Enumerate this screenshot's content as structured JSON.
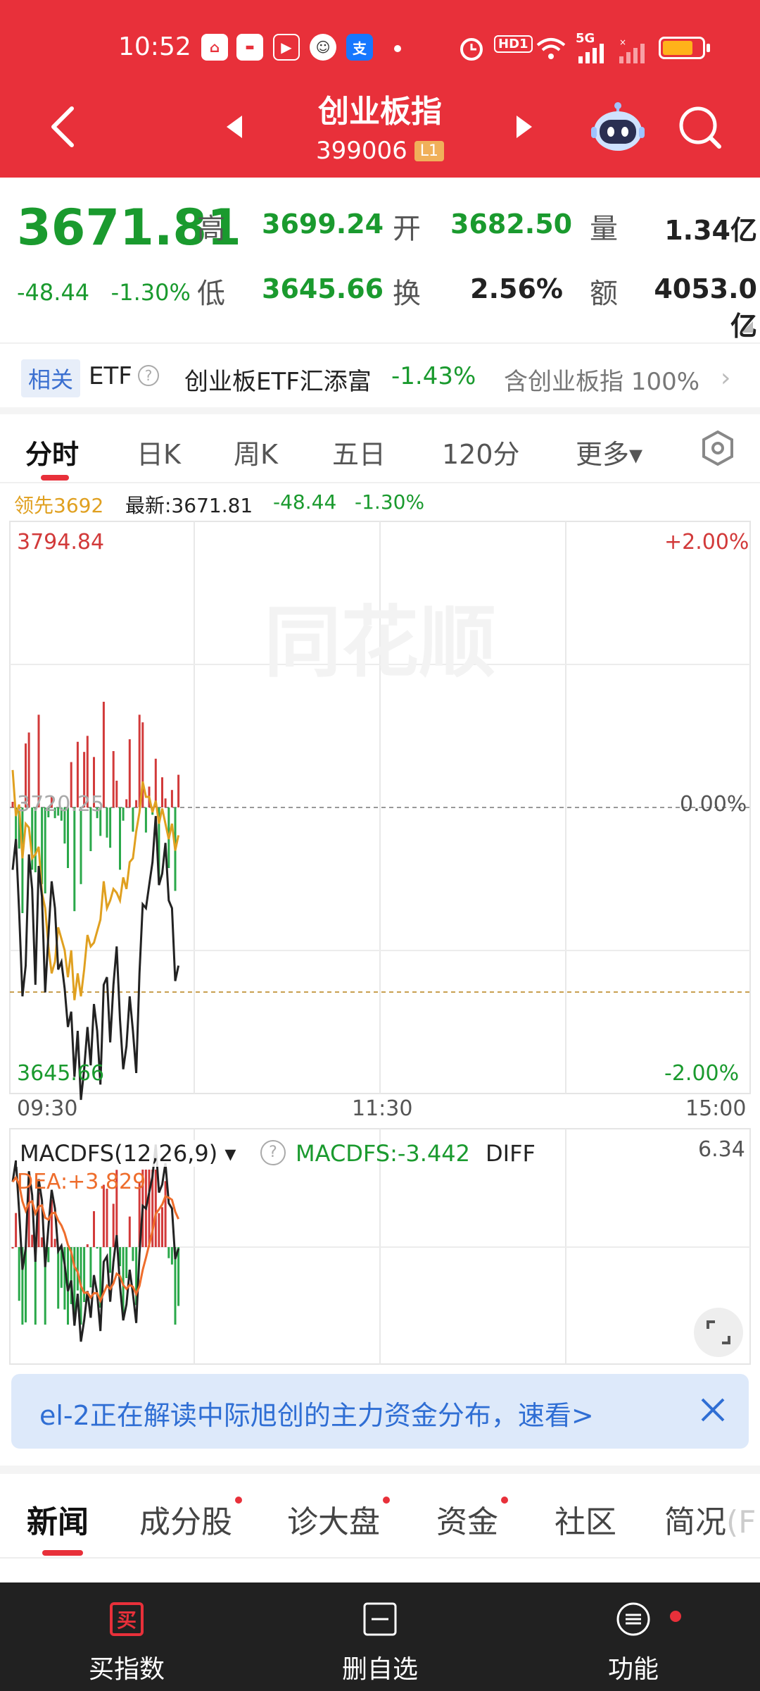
{
  "status_bar": {
    "time": "10:52",
    "network": "5G",
    "hd_label": "HD1"
  },
  "header": {
    "title": "创业板指",
    "code": "399006",
    "level": "L1"
  },
  "quote": {
    "price": "3671.81",
    "change": "-48.44",
    "change_pct": "-1.30%",
    "high_label": "高",
    "high": "3699.24",
    "open_label": "开",
    "open": "3682.50",
    "vol_label": "量",
    "volume": "1.34亿",
    "low_label": "低",
    "low": "3645.66",
    "turnover_label": "换",
    "turnover": "2.56%",
    "amount_label": "额",
    "amount": "4053.0亿"
  },
  "etf": {
    "tag": "相关",
    "label": "ETF",
    "name": "创业板ETF汇添富",
    "change": "-1.43%",
    "contains": "含创业板指 100%"
  },
  "chart_tabs": [
    "分时",
    "日K",
    "周K",
    "五日",
    "120分",
    "更多▾"
  ],
  "legend": {
    "lead": "领先3692",
    "latest": "最新:3671.81",
    "change": "-48.44",
    "change_pct": "-1.30%"
  },
  "chart_axes": {
    "top_price": "3794.84",
    "top_pct": "+2.00%",
    "mid_price": "3720.25",
    "mid_pct": "0.00%",
    "bottom_price": "3645.66",
    "bottom_pct": "-2.00%",
    "times": [
      "09:30",
      "11:30",
      "15:00"
    ]
  },
  "macd": {
    "label": "MACDFS(12,26,9)",
    "value": "MACDFS:-3.442",
    "diff": "DIFF",
    "dea": "DEA:+3.829",
    "max": "6.34"
  },
  "colors": {
    "brand_red": "#e8303a",
    "down_green": "#1a9a2e",
    "lead_line": "#e0a020",
    "price_line": "#222222",
    "dea_line": "#ee6d2c",
    "banner_blue": "#2f6ed4"
  },
  "chart_data": {
    "type": "line",
    "title": "",
    "x_range": [
      "09:30",
      "15:00"
    ],
    "ylim": [
      3645.66,
      3794.84
    ],
    "series": [
      {
        "name": "最新",
        "values": [
          3704,
          3712,
          3693,
          3671,
          3679,
          3708,
          3699,
          3674,
          3705,
          3697,
          3672,
          3687,
          3701,
          3694,
          3678,
          3680,
          3673,
          3663,
          3667,
          3650,
          3662,
          3644,
          3652,
          3663,
          3653,
          3669,
          3662,
          3648,
          3674,
          3676,
          3659,
          3674,
          3684,
          3665,
          3652,
          3658,
          3671,
          3662,
          3651,
          3677,
          3695,
          3694,
          3700,
          3706,
          3718,
          3700,
          3703,
          3711,
          3696,
          3694,
          3675,
          3679
        ]
      },
      {
        "name": "领先",
        "values": [
          3730,
          3718,
          3721,
          3707,
          3716,
          3715,
          3707,
          3708,
          3710,
          3698,
          3694,
          3684,
          3677,
          3680,
          3689,
          3686,
          3683,
          3676,
          3683,
          3670,
          3677,
          3671,
          3678,
          3687,
          3684,
          3685,
          3688,
          3691,
          3701,
          3694,
          3696,
          3699,
          3698,
          3696,
          3702,
          3699,
          3706,
          3707,
          3714,
          3719,
          3727,
          3723,
          3723,
          3719,
          3722,
          3716,
          3720,
          3716,
          3712,
          3716,
          3709,
          3713
        ]
      }
    ]
  }
}
